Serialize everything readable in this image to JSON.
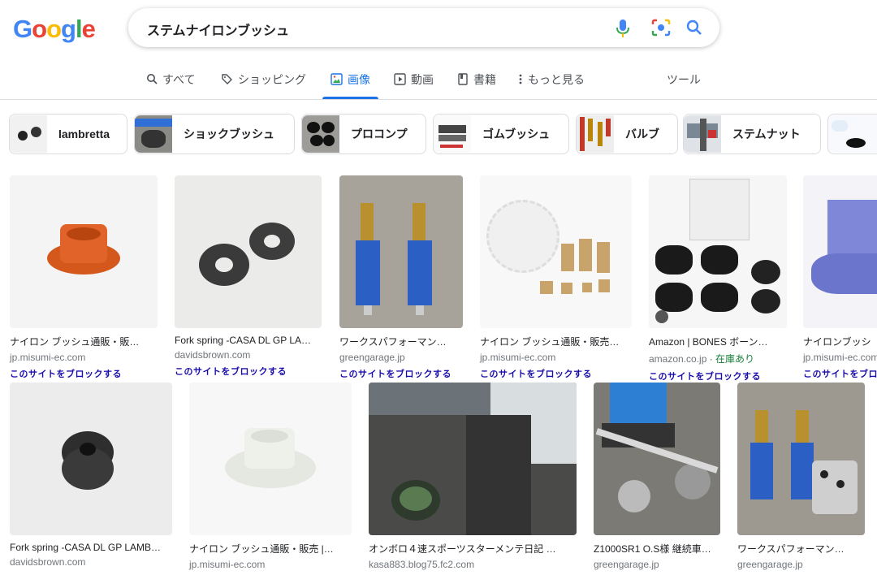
{
  "logo": [
    "G",
    "o",
    "o",
    "g",
    "l",
    "e"
  ],
  "search": {
    "query": "ステムナイロンブッシュ"
  },
  "tabs": [
    {
      "label": "すべて"
    },
    {
      "label": "ショッピング"
    },
    {
      "label": "画像"
    },
    {
      "label": "動画"
    },
    {
      "label": "書籍"
    },
    {
      "label": "もっと見る"
    }
  ],
  "tools_label": "ツール",
  "chips": [
    "lambretta",
    "ショックブッシュ",
    "プロコンプ",
    "ゴムブッシュ",
    "バルブ",
    "ステムナット"
  ],
  "results_row1": [
    {
      "title": "ナイロン ブッシュ通販・販…",
      "site": "jp.misumi-ec.com",
      "block": "このサイトをブロックする"
    },
    {
      "title": "Fork spring -CASA DL GP LA…",
      "site": "davidsbrown.com",
      "block": "このサイトをブロックする"
    },
    {
      "title": "ワークスパフォーマン…",
      "site": "greengarage.jp",
      "block": "このサイトをブロックする"
    },
    {
      "title": "ナイロン ブッシュ通販・販売…",
      "site": "jp.misumi-ec.com",
      "block": "このサイトをブロックする"
    },
    {
      "title": "Amazon | BONES ボーン…",
      "site": "amazon.co.jp",
      "stock": " · 在庫あり",
      "block": "このサイトをブロックする"
    },
    {
      "title": "ナイロンブッシ",
      "site": "jp.misumi-ec.com",
      "block": "このサイトをブロックする"
    }
  ],
  "results_row2": [
    {
      "title": "Fork spring -CASA DL GP LAMB…",
      "site": "davidsbrown.com"
    },
    {
      "title": "ナイロン ブッシュ通販・販売 |…",
      "site": "jp.misumi-ec.com"
    },
    {
      "title": "オンボロ４速スポーツスターメンテ日記 …",
      "site": "kasa883.blog75.fc2.com"
    },
    {
      "title": "Z1000SR1 O.S様 継続車…",
      "site": "greengarage.jp"
    },
    {
      "title": "ワークスパフォーマン…",
      "site": "greengarage.jp"
    }
  ],
  "colors": {
    "google_blue": "#4285f4",
    "google_red": "#ea4335",
    "google_yellow": "#fbbc05",
    "google_green": "#34a853",
    "active_tab": "#1a73e8",
    "link": "#1a0dab"
  }
}
